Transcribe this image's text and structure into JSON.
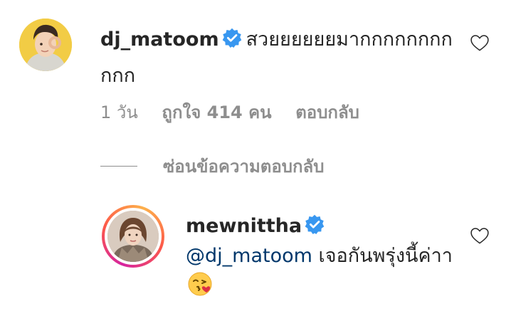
{
  "comment": {
    "avatar_icon": "user-avatar",
    "username": "dj_matoom",
    "text": "สวยยยยยยมากกกกกกกกกกก",
    "time": "1 วัน",
    "likes": "ถูกใจ 414 คน",
    "reply_label": "ตอบกลับ"
  },
  "hide_replies_label": "ซ่อนข้อความตอบกลับ",
  "reply": {
    "avatar_icon": "user-avatar",
    "username": "mewnittha",
    "mention": "@dj_matoom",
    "text": " เจอกันพรุ่งนี้ค่าา"
  },
  "colors": {
    "text": "#262626",
    "secondary": "#8e8e8e",
    "mention": "#00376b",
    "verified": "#3897f0"
  },
  "icons": {
    "verified": "verified-badge-icon",
    "like": "heart-outline-icon",
    "emoji": "face-blowing-kiss-emoji"
  }
}
